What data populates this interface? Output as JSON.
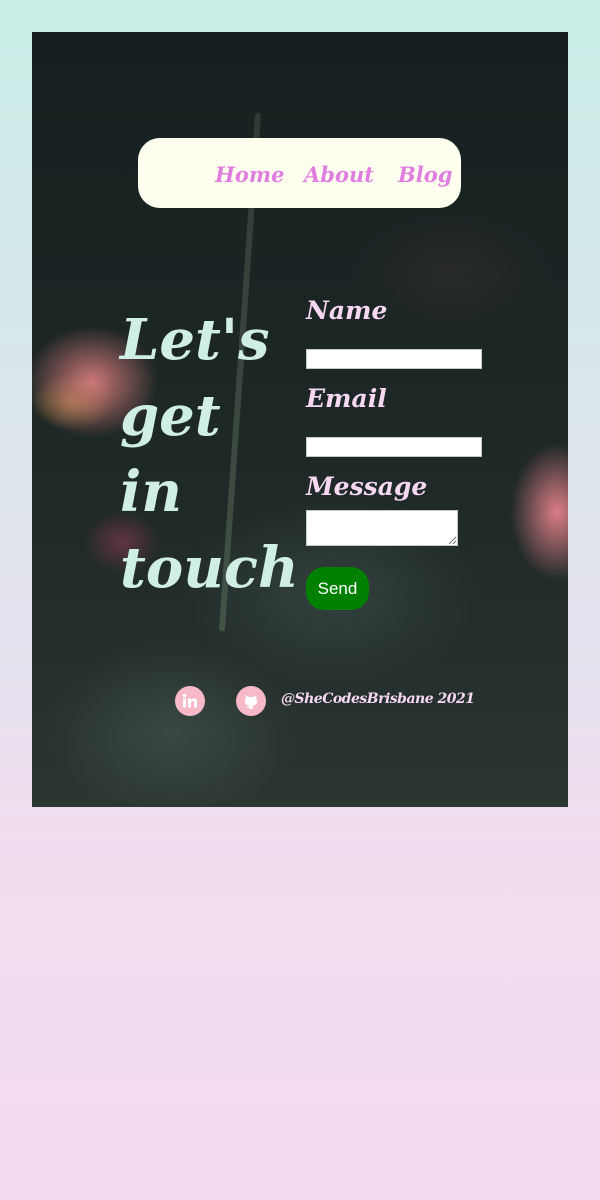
{
  "nav": {
    "items": [
      {
        "label": "Home"
      },
      {
        "label": "About"
      },
      {
        "label": "Blog"
      }
    ]
  },
  "hero": {
    "lines": [
      "Let's",
      "get",
      "in",
      "touch"
    ]
  },
  "form": {
    "name_label": "Name",
    "name_value": "",
    "email_label": "Email",
    "email_value": "",
    "message_label": "Message",
    "message_value": "",
    "send_label": "Send"
  },
  "footer": {
    "handle": "@SheCodesBrisbane 2021",
    "social_icons": [
      "linkedin-icon",
      "github-icon"
    ]
  },
  "colors": {
    "nav_background": "#fffff0",
    "nav_link": "#e07ee0",
    "hero_text": "#cfeee6",
    "label_text": "#f6d8f2",
    "send_button": "#008000",
    "social_icon_bg": "#f7b9c8"
  }
}
